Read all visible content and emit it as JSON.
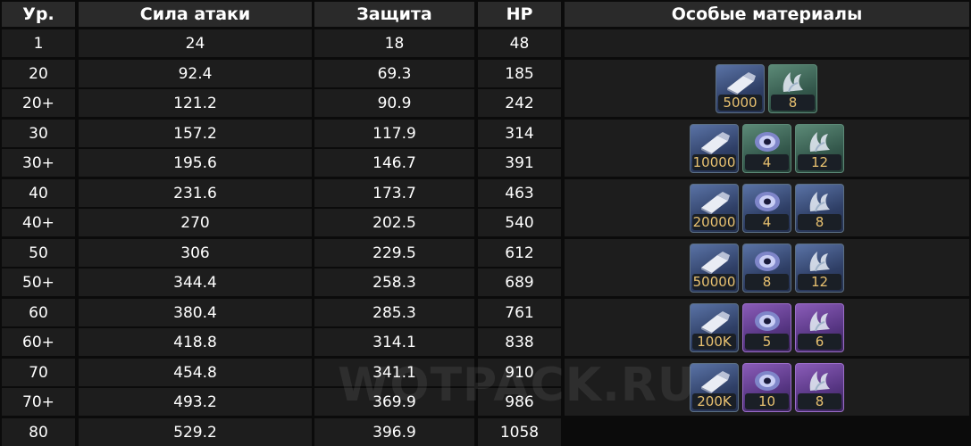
{
  "headers": [
    "Ур.",
    "Сила атаки",
    "Защита",
    "HP",
    "Особые материалы"
  ],
  "rows": [
    {
      "lvl": "1",
      "atk": "24",
      "def": "18",
      "hp": "48"
    },
    {
      "lvl": "20",
      "atk": "92.4",
      "def": "69.3",
      "hp": "185"
    },
    {
      "lvl": "20+",
      "atk": "121.2",
      "def": "90.9",
      "hp": "242"
    },
    {
      "lvl": "30",
      "atk": "157.2",
      "def": "117.9",
      "hp": "314"
    },
    {
      "lvl": "30+",
      "atk": "195.6",
      "def": "146.7",
      "hp": "391"
    },
    {
      "lvl": "40",
      "atk": "231.6",
      "def": "173.7",
      "hp": "463"
    },
    {
      "lvl": "40+",
      "atk": "270",
      "def": "202.5",
      "hp": "540"
    },
    {
      "lvl": "50",
      "atk": "306",
      "def": "229.5",
      "hp": "612"
    },
    {
      "lvl": "50+",
      "atk": "344.4",
      "def": "258.3",
      "hp": "689"
    },
    {
      "lvl": "60",
      "atk": "380.4",
      "def": "285.3",
      "hp": "761"
    },
    {
      "lvl": "60+",
      "atk": "418.8",
      "def": "314.1",
      "hp": "838"
    },
    {
      "lvl": "70",
      "atk": "454.8",
      "def": "341.1",
      "hp": "910"
    },
    {
      "lvl": "70+",
      "atk": "493.2",
      "def": "369.9",
      "hp": "986"
    },
    {
      "lvl": "80",
      "atk": "529.2",
      "def": "396.9",
      "hp": "1058"
    }
  ],
  "materials": [
    [
      {
        "icon": "credits-icon",
        "rarity": "blue",
        "qty": "5000"
      },
      {
        "icon": "claw-material-icon",
        "rarity": "green",
        "qty": "8"
      }
    ],
    [
      {
        "icon": "credits-icon",
        "rarity": "blue",
        "qty": "10000"
      },
      {
        "icon": "orb-material-icon",
        "rarity": "green",
        "qty": "4"
      },
      {
        "icon": "claw-material-icon",
        "rarity": "green",
        "qty": "12"
      }
    ],
    [
      {
        "icon": "credits-icon",
        "rarity": "blue",
        "qty": "20000"
      },
      {
        "icon": "orb-material-icon",
        "rarity": "blue",
        "qty": "4"
      },
      {
        "icon": "claw-material-icon",
        "rarity": "blue",
        "qty": "8"
      }
    ],
    [
      {
        "icon": "credits-icon",
        "rarity": "blue",
        "qty": "50000"
      },
      {
        "icon": "orb-material-icon",
        "rarity": "blue",
        "qty": "8"
      },
      {
        "icon": "claw-material-icon",
        "rarity": "blue",
        "qty": "12"
      }
    ],
    [
      {
        "icon": "credits-icon",
        "rarity": "blue",
        "qty": "100K"
      },
      {
        "icon": "orb-material-icon",
        "rarity": "purple",
        "qty": "5"
      },
      {
        "icon": "claw-material-icon",
        "rarity": "purple",
        "qty": "6"
      }
    ],
    [
      {
        "icon": "credits-icon",
        "rarity": "blue",
        "qty": "200K"
      },
      {
        "icon": "orb-material-icon",
        "rarity": "purple",
        "qty": "10"
      },
      {
        "icon": "claw-material-icon",
        "rarity": "purple",
        "qty": "8"
      }
    ]
  ],
  "watermark": "WOTPACK.RU",
  "colors": {
    "background": "#0b0b0b",
    "cell": "#1d1d1d",
    "header": "#2a2a2a",
    "quantity": "#e8c170"
  }
}
